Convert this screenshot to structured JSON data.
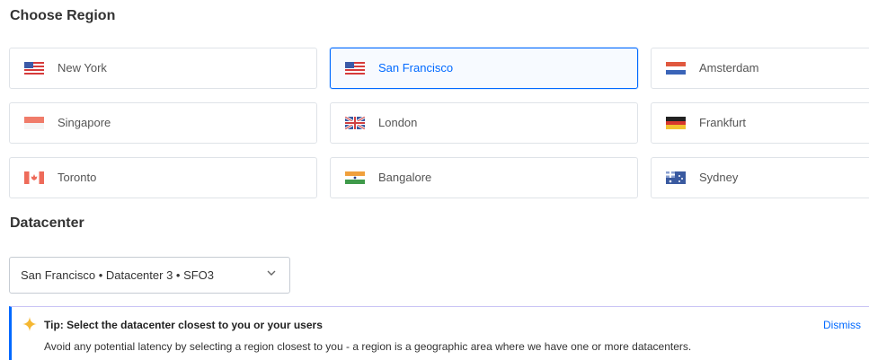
{
  "region_section": {
    "title": "Choose Region",
    "regions": [
      {
        "name": "New York",
        "flag": "us-flag-icon",
        "selected": false
      },
      {
        "name": "San Francisco",
        "flag": "us-flag-icon",
        "selected": true
      },
      {
        "name": "Amsterdam",
        "flag": "nl-flag-icon",
        "selected": false
      },
      {
        "name": "Singapore",
        "flag": "sg-flag-icon",
        "selected": false
      },
      {
        "name": "London",
        "flag": "uk-flag-icon",
        "selected": false
      },
      {
        "name": "Frankfurt",
        "flag": "de-flag-icon",
        "selected": false
      },
      {
        "name": "Toronto",
        "flag": "ca-flag-icon",
        "selected": false
      },
      {
        "name": "Bangalore",
        "flag": "in-flag-icon",
        "selected": false
      },
      {
        "name": "Sydney",
        "flag": "au-flag-icon",
        "selected": false
      }
    ]
  },
  "datacenter_section": {
    "title": "Datacenter",
    "selected_value": "San Francisco • Datacenter 3 • SFO3"
  },
  "tip": {
    "icon": "sparkle-icon",
    "title": "Tip: Select the datacenter closest to you or your users",
    "body": "Avoid any potential latency by selecting a region closest to you - a region is a geographic area where we have one or more datacenters.",
    "dismiss_label": "Dismiss"
  },
  "colors": {
    "accent": "#0069ff",
    "border": "#dfe3e8",
    "tip_border": "#c9c4f5"
  }
}
